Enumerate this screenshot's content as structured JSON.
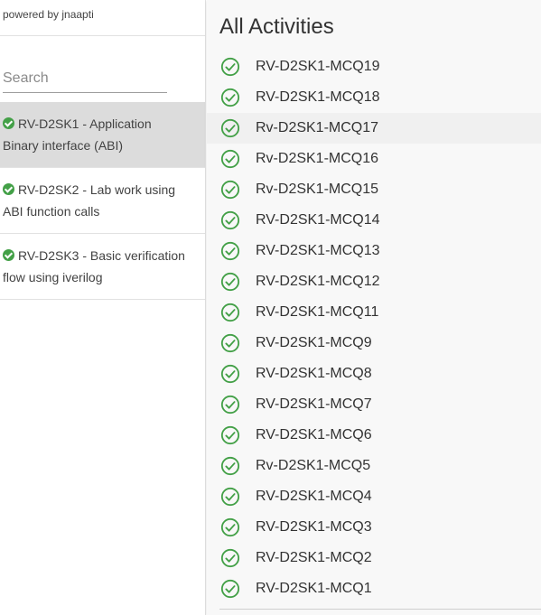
{
  "sidebar": {
    "powered_by": "powered by jnaapti",
    "search": {
      "placeholder": "Search",
      "value": ""
    },
    "skills": [
      {
        "label": "RV-D2SK1 - Application Binary interface (ABI)",
        "status": "completed",
        "active": true
      },
      {
        "label": "RV-D2SK2 - Lab work using ABI function calls",
        "status": "completed",
        "active": false
      },
      {
        "label": "RV-D2SK3 - Basic verification flow using iverilog",
        "status": "completed",
        "active": false
      }
    ]
  },
  "main": {
    "title": "All Activities",
    "activities": [
      {
        "label": "RV-D2SK1-MCQ19"
      },
      {
        "label": "RV-D2SK1-MCQ18"
      },
      {
        "label": "Rv-D2SK1-MCQ17"
      },
      {
        "label": "Rv-D2SK1-MCQ16"
      },
      {
        "label": "Rv-D2SK1-MCQ15"
      },
      {
        "label": "RV-D2SK1-MCQ14"
      },
      {
        "label": "RV-D2SK1-MCQ13"
      },
      {
        "label": "RV-D2SK1-MCQ12"
      },
      {
        "label": "RV-D2SK1-MCQ11"
      },
      {
        "label": "RV-D2SK1-MCQ9"
      },
      {
        "label": "RV-D2SK1-MCQ8"
      },
      {
        "label": "RV-D2SK1-MCQ7"
      },
      {
        "label": "RV-D2SK1-MCQ6"
      },
      {
        "label": "Rv-D2SK1-MCQ5"
      },
      {
        "label": "RV-D2SK1-MCQ4"
      },
      {
        "label": "RV-D2SK1-MCQ3"
      },
      {
        "label": "RV-D2SK1-MCQ2"
      },
      {
        "label": "RV-D2SK1-MCQ1"
      }
    ]
  },
  "colors": {
    "completed": "#43a047",
    "active_item_bg": "#dcdcdc",
    "main_bg": "#f8f8f8"
  },
  "icons": {
    "skill_status": "check-circle-filled-icon",
    "activity_status": "check-circle-outline-icon"
  }
}
